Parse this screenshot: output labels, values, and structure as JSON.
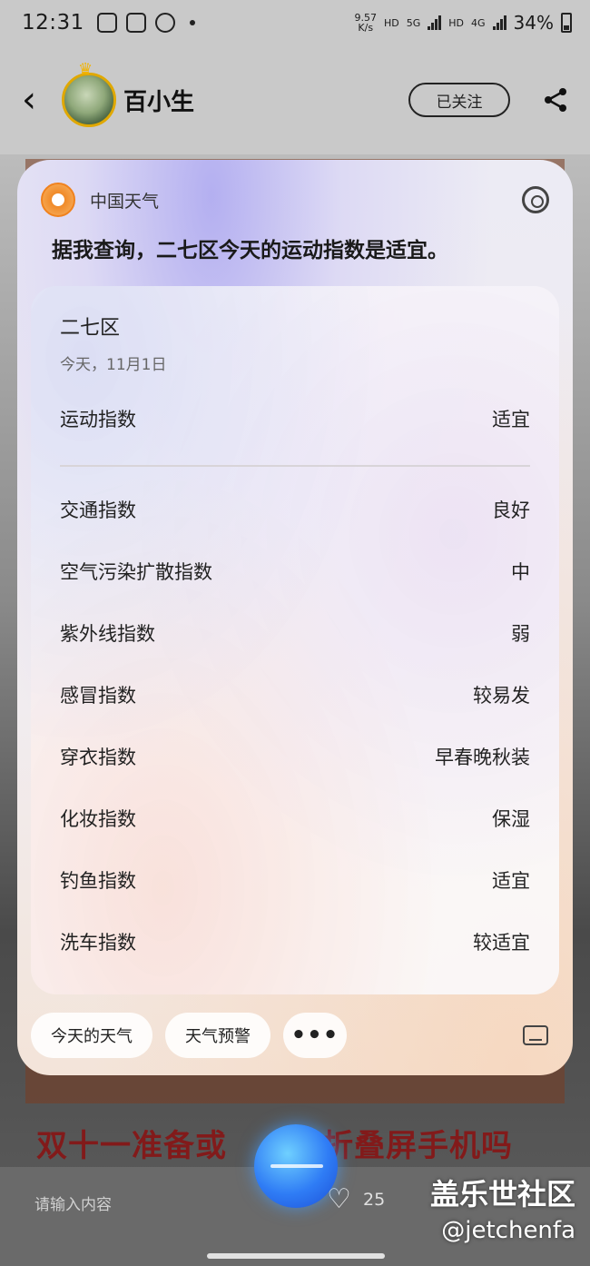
{
  "status_bar": {
    "time": "12:31",
    "net_speed_value": "9.57",
    "net_speed_unit": "K/s",
    "hd1": "HD",
    "network": "5G",
    "hd2": "HD",
    "network2": "4G",
    "battery": "34%"
  },
  "header": {
    "back_icon": "back-arrow",
    "username": "百小生",
    "follow_label": "已关注",
    "share_icon": "share"
  },
  "assistant": {
    "app_name": "中国天气",
    "answer": "据我查询，二七区今天的运动指数是适宜。",
    "location": "二七区",
    "date": "今天，11月1日",
    "primary": {
      "label": "运动指数",
      "value": "适宜"
    },
    "indices": [
      {
        "label": "交通指数",
        "value": "良好"
      },
      {
        "label": "空气污染扩散指数",
        "value": "中"
      },
      {
        "label": "紫外线指数",
        "value": "弱"
      },
      {
        "label": "感冒指数",
        "value": "较易发"
      },
      {
        "label": "穿衣指数",
        "value": "早春晚秋装"
      },
      {
        "label": "化妆指数",
        "value": "保湿"
      },
      {
        "label": "钓鱼指数",
        "value": "适宜"
      },
      {
        "label": "洗车指数",
        "value": "较适宜"
      }
    ],
    "chips": [
      "今天的天气",
      "天气预警",
      "•••"
    ]
  },
  "background": {
    "headline": "双十一准备或",
    "headline_tail": "了折叠屏手机吗",
    "comment_placeholder": "请输入内容",
    "like_count": "25",
    "watermark_site": "盖乐世社区",
    "watermark_user": "@jetchenfa"
  },
  "colors": {
    "accent_orange": "#f0821d",
    "card_purple": "#aaa5f0",
    "headline_red": "#8a1010"
  }
}
